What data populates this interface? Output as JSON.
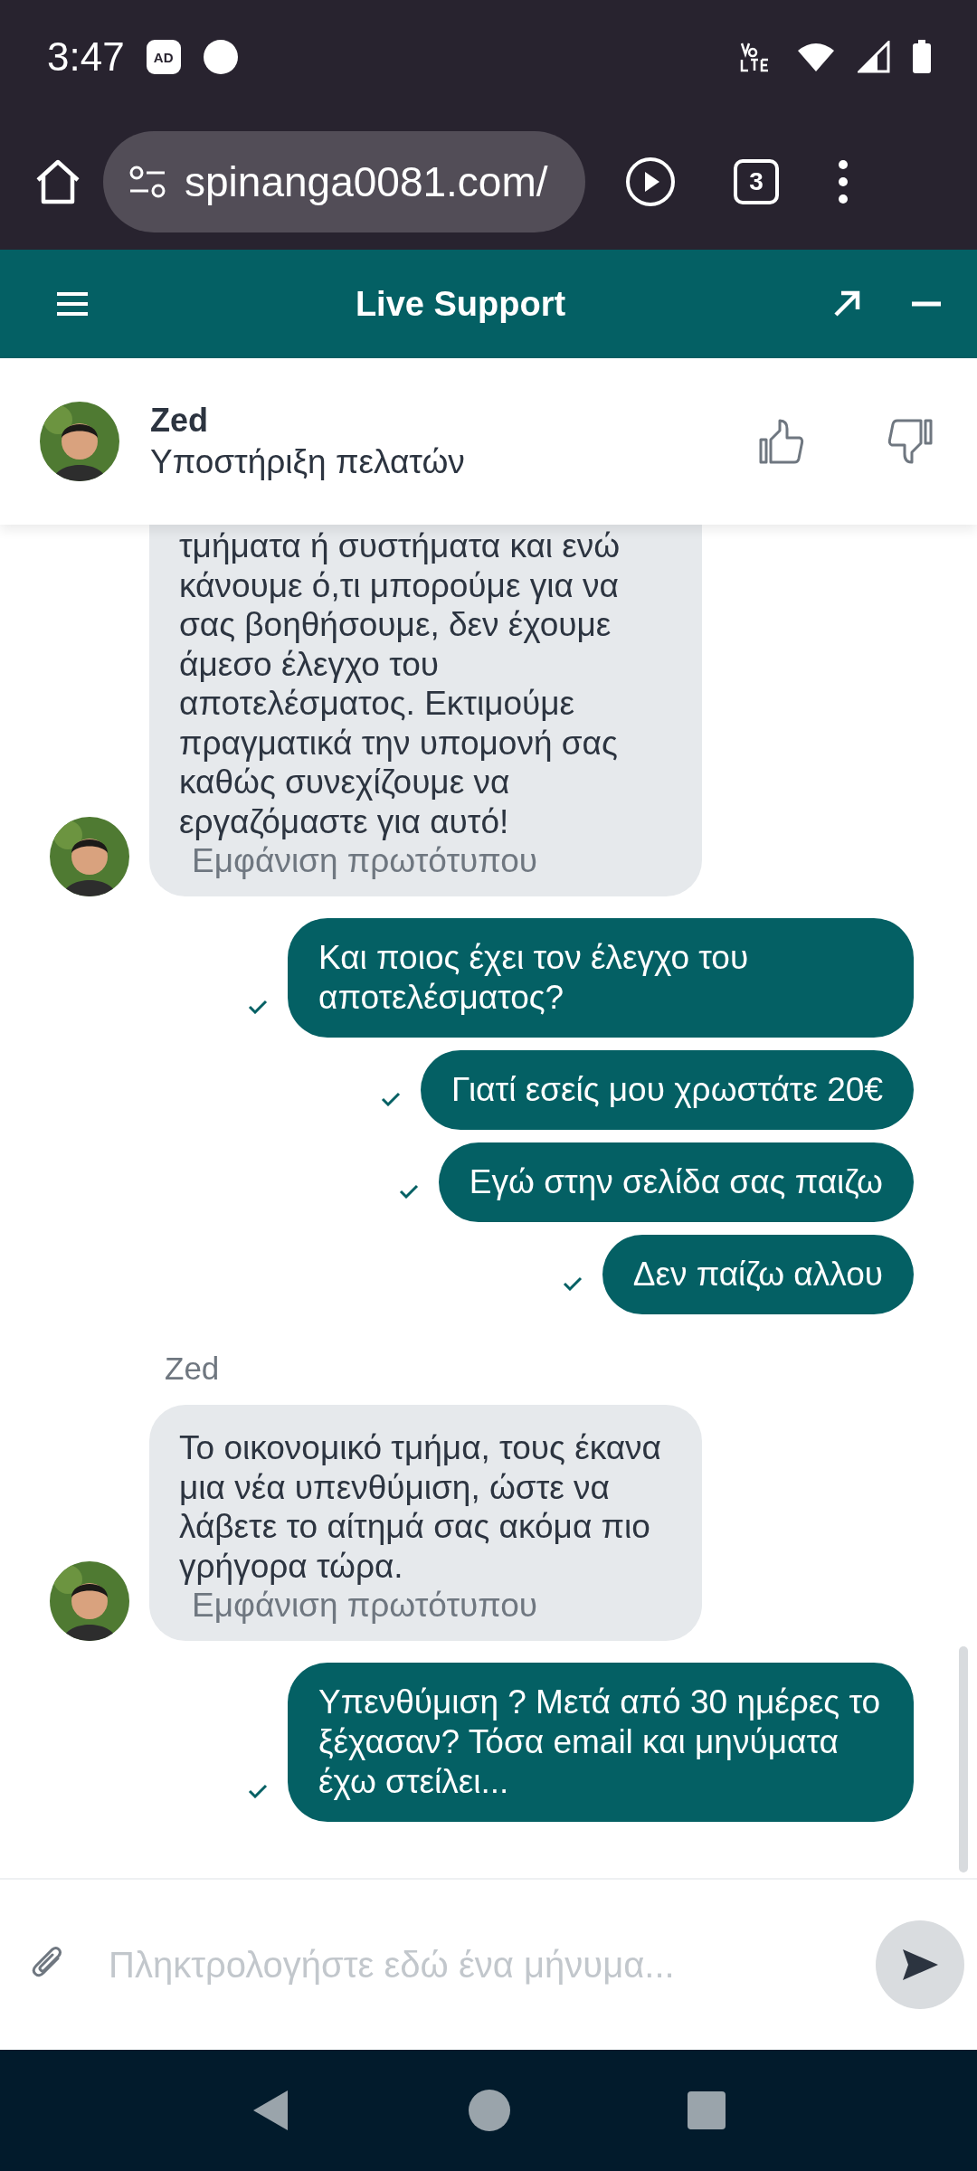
{
  "status_bar": {
    "time": "3:47",
    "adblock_badge": "AD"
  },
  "browser": {
    "url": "spinanga0081.com/",
    "tab_count": "3"
  },
  "chat_header": {
    "title": "Live Support"
  },
  "agent": {
    "name": "Zed",
    "role": "Υποστήριξη πελατών"
  },
  "messages": [
    {
      "kind": "agent",
      "text": "τμήματα ή συστήματα και ενώ κάνουμε ό,τι μπορούμε για να σας βοηθήσουμε, δεν έχουμε άμεσο έλεγχο του αποτελέσματος. Εκτιμούμε πραγματικά την υπομονή σας καθώς συνεχίζουμε να εργαζόμαστε για αυτό!",
      "link": "Εμφάνιση πρωτότυπου",
      "cut_top": true
    },
    {
      "kind": "user",
      "text": "Και ποιος έχει τον έλεγχο του αποτελέσματος?",
      "delivered": true
    },
    {
      "kind": "user",
      "text": "Γιατί εσείς μου χρωστάτε 20€",
      "delivered": true
    },
    {
      "kind": "user",
      "text": "Εγώ στην σελίδα σας παιζω",
      "delivered": true
    },
    {
      "kind": "user",
      "text": "Δεν παίζω αλλου",
      "delivered": true
    },
    {
      "kind": "sender",
      "text": "Zed"
    },
    {
      "kind": "agent",
      "text": "Το οικονομικό τμήμα, τους έκανα μια νέα υπενθύμιση, ώστε να λάβετε το αίτημά σας ακόμα πιο γρήγορα τώρα.",
      "link": "Εμφάνιση πρωτότυπου",
      "cut_top": false
    },
    {
      "kind": "user",
      "text": "Υπενθύμιση ? Μετά από 30 ημέρες το ξέχασαν? Τόσα email και μηνύματα έχω στείλει...",
      "delivered": true
    }
  ],
  "composer": {
    "placeholder": "Πληκτρολογήστε εδώ ένα μήνυμα..."
  }
}
